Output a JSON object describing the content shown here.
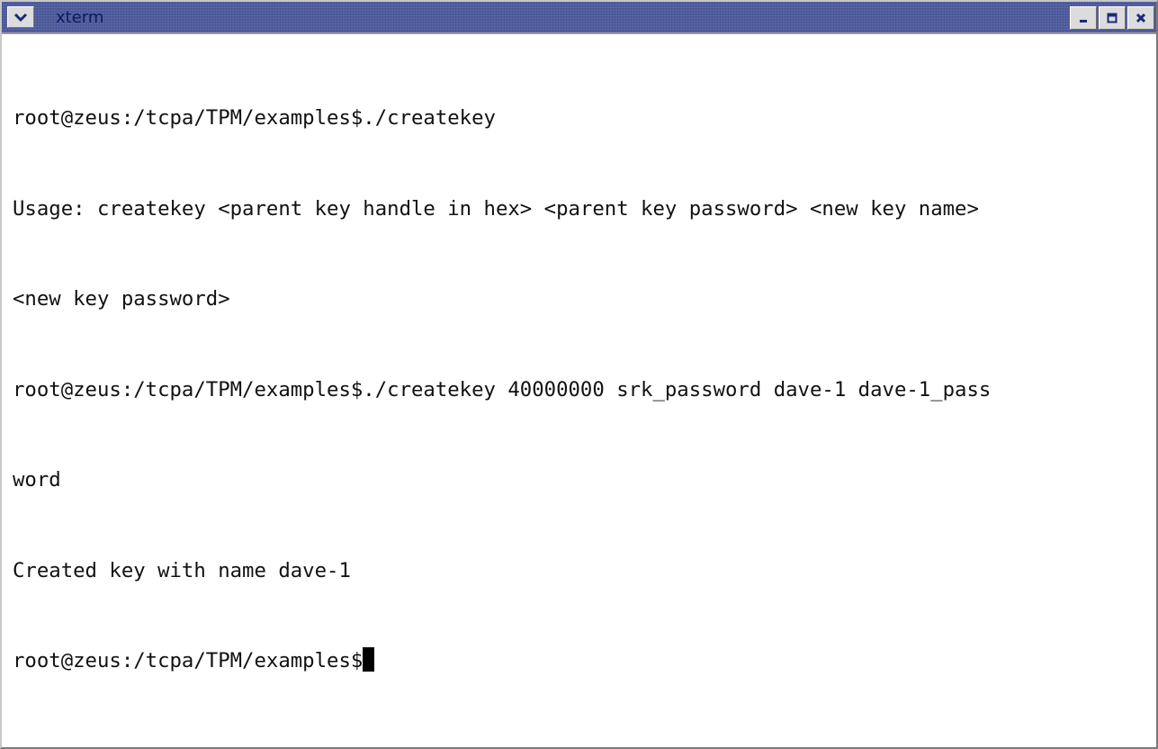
{
  "window": {
    "title": "xterm",
    "titlebar_color": "#4f5b9e",
    "title_color": "#0b1a60",
    "icons": {
      "menu": "chevron-down-icon",
      "minimize": "minimize-icon",
      "maximize": "maximize-icon",
      "close": "close-icon"
    }
  },
  "terminal": {
    "background": "#ffffff",
    "foreground": "#111111",
    "lines": [
      "root@zeus:/tcpa/TPM/examples$./createkey",
      "Usage: createkey <parent key handle in hex> <parent key password> <new key name>",
      "<new key password>",
      "root@zeus:/tcpa/TPM/examples$./createkey 40000000 srk_password dave-1 dave-1_pass",
      "word",
      "Created key with name dave-1"
    ],
    "prompt": "root@zeus:/tcpa/TPM/examples$"
  }
}
